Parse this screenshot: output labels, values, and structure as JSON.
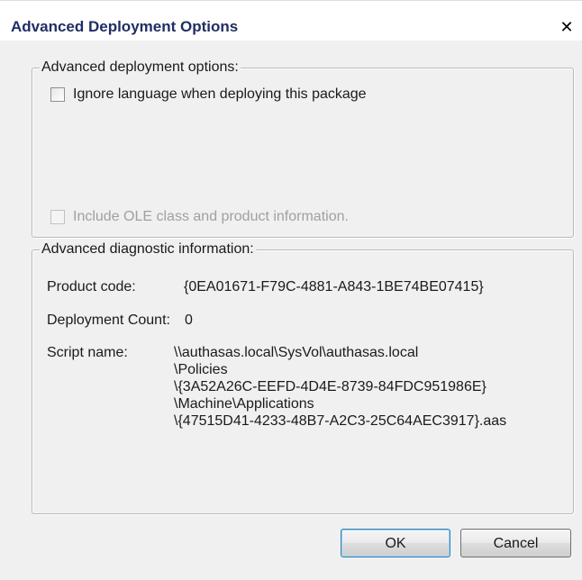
{
  "window": {
    "title": "Advanced Deployment Options",
    "close_glyph": "✕"
  },
  "deployment_group": {
    "label": "Advanced deployment options:",
    "ignore_language": {
      "label": "Ignore language when deploying this package",
      "checked": false,
      "enabled": true
    },
    "include_ole": {
      "label": "Include OLE class and product information.",
      "checked": false,
      "enabled": false
    }
  },
  "diagnostic_group": {
    "label": "Advanced diagnostic information:",
    "product_code_label": "Product code:",
    "product_code_value": "{0EA01671-F79C-4881-A843-1BE74BE07415}",
    "deployment_count_label": "Deployment Count:",
    "deployment_count_value": "0",
    "script_name_label": "Script name:",
    "script_name_lines": [
      "\\\\authasas.local\\SysVol\\authasas.local",
      "\\Policies",
      "\\{3A52A26C-EEFD-4D4E-8739-84FDC951986E}",
      "\\Machine\\Applications",
      "\\{47515D41-4233-48B7-A2C3-25C64AEC3917}.aas"
    ]
  },
  "buttons": {
    "ok": "OK",
    "cancel": "Cancel"
  }
}
